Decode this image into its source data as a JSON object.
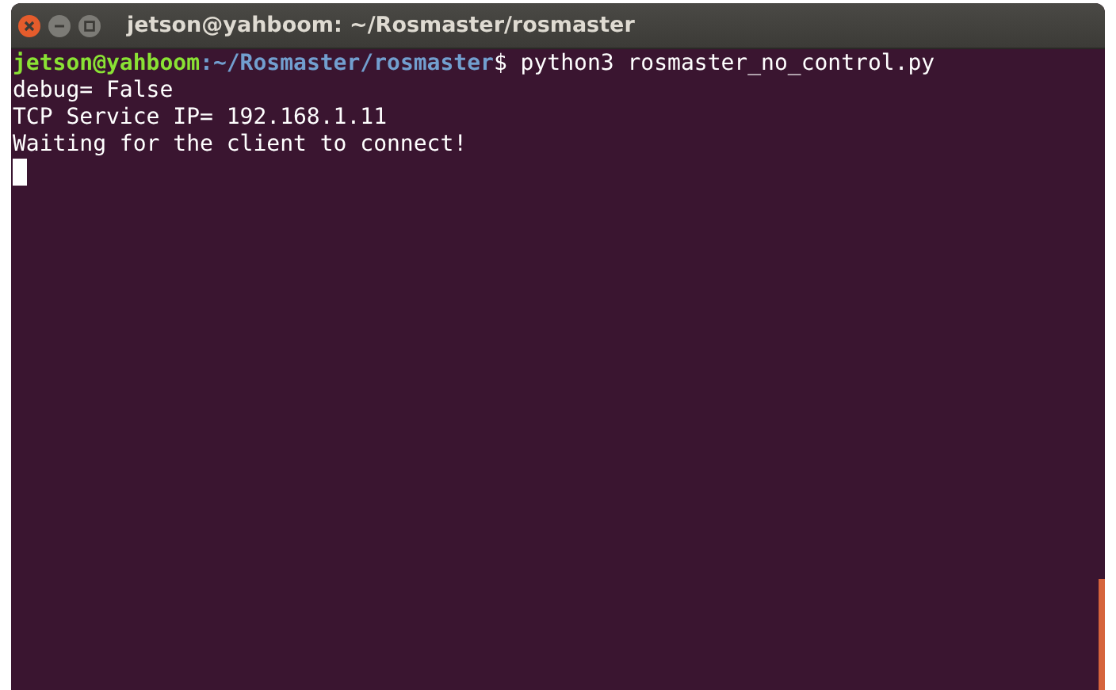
{
  "window": {
    "title": "jetson@yahboom: ~/Rosmaster/rosmaster"
  },
  "terminal": {
    "prompt": {
      "user_host": "jetson@yahboom",
      "path": ":~/Rosmaster/rosmaster",
      "command": "$ python3 rosmaster_no_control.py"
    },
    "output": [
      "debug= False",
      "TCP Service IP= 192.168.1.11",
      "Waiting for the client to connect!"
    ],
    "cursor": true
  }
}
